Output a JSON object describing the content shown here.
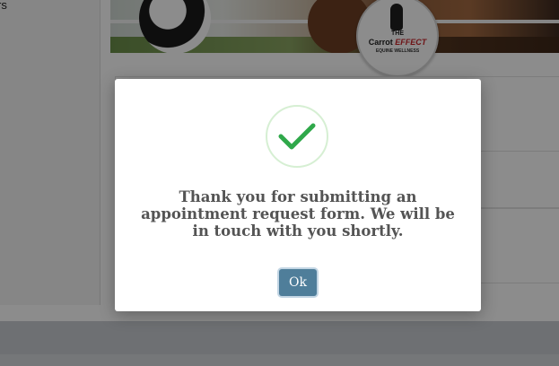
{
  "background_page": {
    "left_fragment": "rs",
    "logo": {
      "the": "THE",
      "name_part1": "Carrot",
      "name_part2": "EFFECT",
      "subtitle": "EQUINE WELLNESS"
    }
  },
  "modal": {
    "icon": "checkmark-icon",
    "message": "Thank you for submitting an appointment request form. We will be in touch with you shortly.",
    "ok_label": "Ok"
  },
  "colors": {
    "success": "#2fa84a",
    "button": "#4f7e9a",
    "text": "#545454"
  }
}
